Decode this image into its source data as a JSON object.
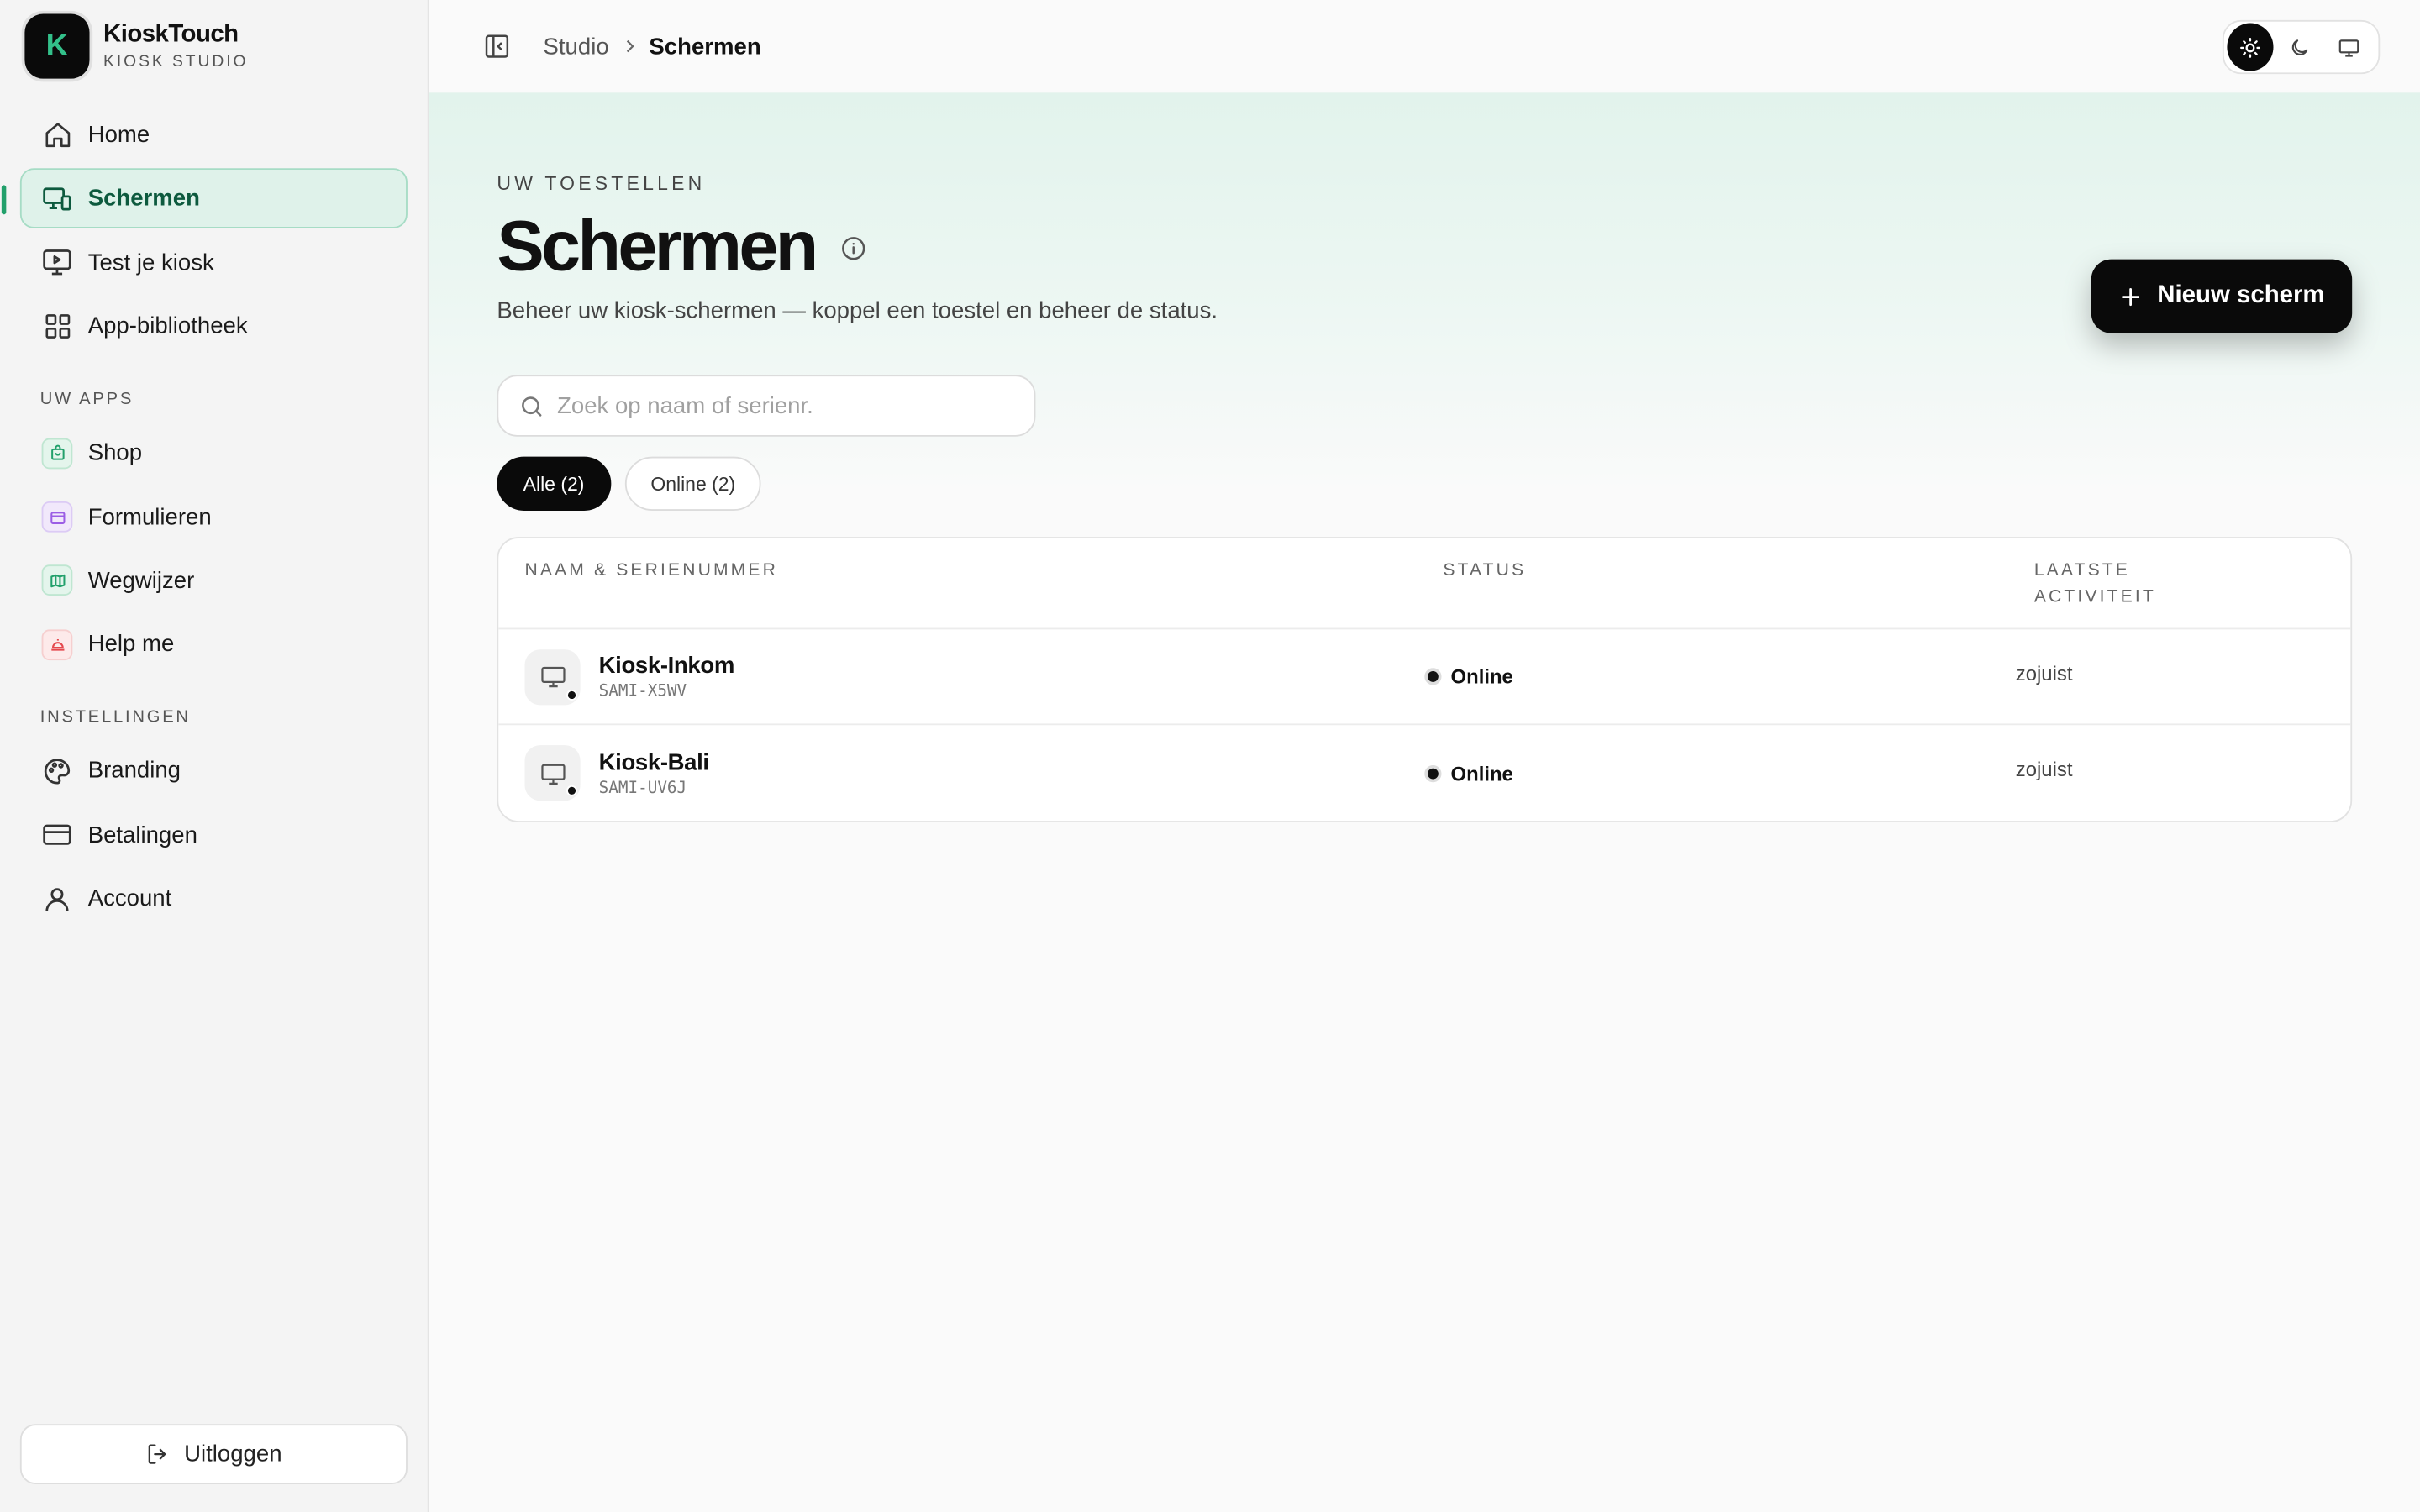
{
  "brand": {
    "logo_letter": "K",
    "name": "KioskTouch",
    "subtitle": "KIOSK STUDIO"
  },
  "sidebar": {
    "nav": [
      {
        "label": "Home",
        "icon": "home-icon"
      },
      {
        "label": "Schermen",
        "icon": "monitor-devices-icon",
        "active": true
      },
      {
        "label": "Test je kiosk",
        "icon": "play-screen-icon"
      },
      {
        "label": "App-bibliotheek",
        "icon": "grid-icon"
      }
    ],
    "apps_label": "UW APPS",
    "apps": [
      {
        "label": "Shop",
        "icon": "shop-bag-icon",
        "color": "#22a06b"
      },
      {
        "label": "Formulieren",
        "icon": "form-icon",
        "color": "#9b5de5"
      },
      {
        "label": "Wegwijzer",
        "icon": "map-icon",
        "color": "#22a06b"
      },
      {
        "label": "Help me",
        "icon": "bell-icon",
        "color": "#e5484d"
      }
    ],
    "settings_label": "INSTELLINGEN",
    "settings": [
      {
        "label": "Branding",
        "icon": "palette-icon"
      },
      {
        "label": "Betalingen",
        "icon": "credit-card-icon"
      },
      {
        "label": "Account",
        "icon": "user-icon"
      }
    ],
    "logout_label": "Uitloggen"
  },
  "topbar": {
    "breadcrumb_parent": "Studio",
    "breadcrumb_current": "Schermen",
    "theme_options": [
      "sun-icon",
      "moon-icon",
      "monitor-icon"
    ]
  },
  "page": {
    "eyebrow": "UW TOESTELLEN",
    "title": "Schermen",
    "subtitle": "Beheer uw kiosk-schermen — koppel een toestel en beheer de status.",
    "new_button": "Nieuw scherm"
  },
  "search": {
    "placeholder": "Zoek op naam of serienr.",
    "value": ""
  },
  "filters": [
    {
      "label": "Alle (2)",
      "active": true
    },
    {
      "label": "Online (2)",
      "active": false
    }
  ],
  "table": {
    "columns": [
      "NAAM & SERIENUMMER",
      "STATUS",
      "LAATSTE ACTIVITEIT"
    ],
    "rows": [
      {
        "name": "Kiosk-Inkom",
        "serial": "SAMI-X5WV",
        "status": "Online",
        "activity": "zojuist"
      },
      {
        "name": "Kiosk-Bali",
        "serial": "SAMI-UV6J",
        "status": "Online",
        "activity": "zojuist"
      }
    ]
  },
  "colors": {
    "accent": "#22a06b",
    "active_bg": "#dff2ea",
    "primary_button": "#0a0a0a"
  }
}
